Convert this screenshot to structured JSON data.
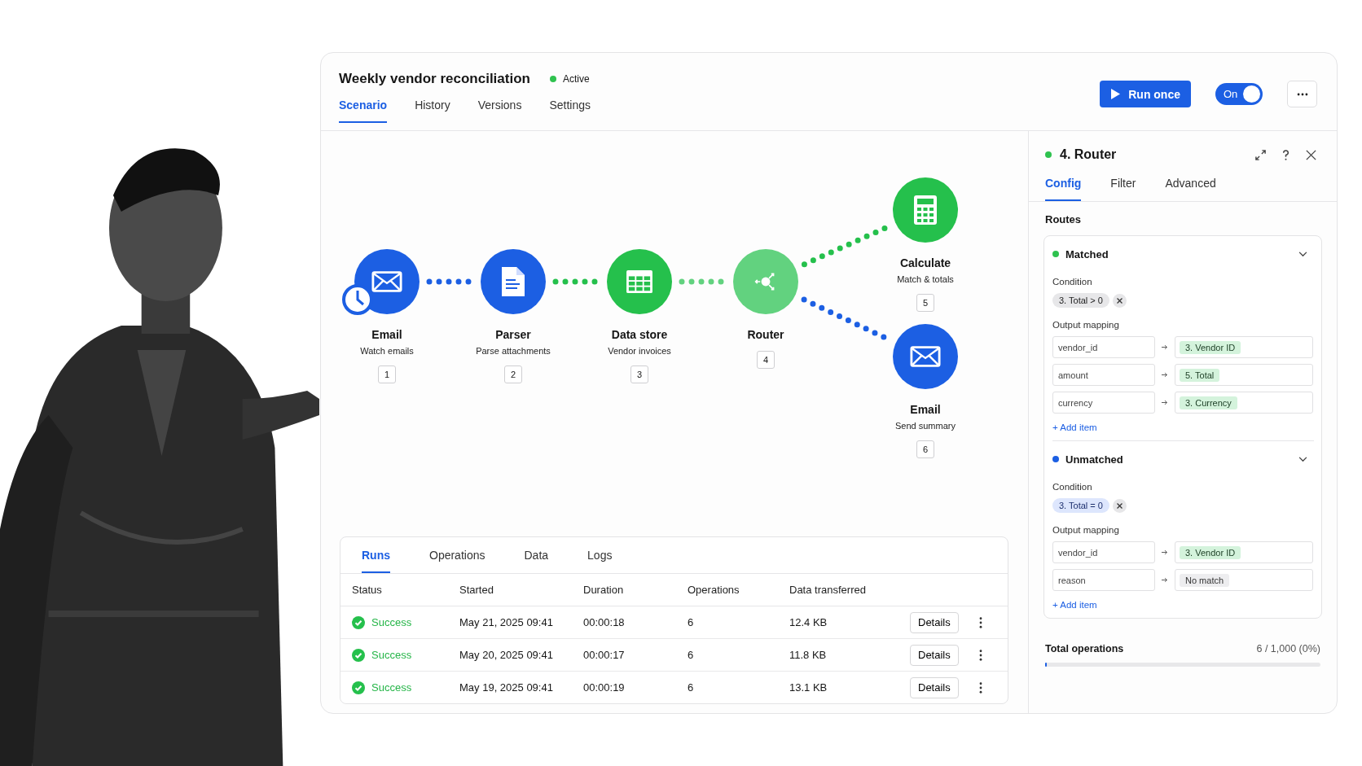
{
  "scenario": {
    "title": "Weekly vendor reconciliation",
    "status": {
      "label": "Active",
      "color": "#2fc24f"
    }
  },
  "tabs": [
    {
      "label": "Scenario",
      "selected": true
    },
    {
      "label": "History",
      "selected": false
    },
    {
      "label": "Versions",
      "selected": false
    },
    {
      "label": "Settings",
      "selected": false
    }
  ],
  "actions": {
    "run_button": "Run once",
    "toggle": {
      "label": "On",
      "on": true
    }
  },
  "flow": {
    "chain": [
      {
        "name": "Email",
        "subtitle": "Watch emails",
        "number": "1",
        "color": "#1c5fe3",
        "kind": "email",
        "scheduled": true
      },
      {
        "name": "Parser",
        "subtitle": "Parse attachments",
        "number": "2",
        "color": "#1c5fe3",
        "kind": "document",
        "scheduled": false
      },
      {
        "name": "Data store",
        "subtitle": "Vendor invoices",
        "number": "3",
        "color": "#25c04c",
        "kind": "table",
        "scheduled": false
      },
      {
        "name": "Router",
        "number": "4",
        "color": "#62d27f",
        "kind": "router",
        "scheduled": false
      }
    ],
    "branches": [
      {
        "name": "Calculate",
        "subtitle": "Match & totals",
        "number": "5",
        "color": "#25c04c",
        "kind": "calculator",
        "scheduled": false
      },
      {
        "name": "Email",
        "subtitle": "Send summary",
        "number": "6",
        "color": "#1c5fe3",
        "kind": "email",
        "scheduled": false
      }
    ]
  },
  "runs": {
    "tabs": [
      {
        "label": "Runs",
        "selected": true
      },
      {
        "label": "Operations",
        "selected": false
      },
      {
        "label": "Data",
        "selected": false
      },
      {
        "label": "Logs",
        "selected": false
      }
    ],
    "columns": [
      "Status",
      "Started",
      "Duration",
      "Operations",
      "Data transferred"
    ],
    "rows": [
      {
        "status": "Success",
        "kind": "success",
        "started": "May 21, 2025 09:41",
        "duration": "00:00:18",
        "operations": "6",
        "data": "12.4 KB",
        "action": "Details"
      },
      {
        "status": "Success",
        "kind": "success",
        "started": "May 20, 2025 09:41",
        "duration": "00:00:17",
        "operations": "6",
        "data": "11.8 KB",
        "action": "Details"
      },
      {
        "status": "Success",
        "kind": "success",
        "started": "May 19, 2025 09:41",
        "duration": "00:00:19",
        "operations": "6",
        "data": "13.1 KB",
        "action": "Details"
      }
    ]
  },
  "panel": {
    "title": "4. Router",
    "status": {
      "color": "#2fc24f"
    },
    "tabs": [
      {
        "label": "Config",
        "selected": true
      },
      {
        "label": "Filter",
        "selected": false
      },
      {
        "label": "Advanced",
        "selected": false
      }
    ],
    "section": "Routes",
    "routes": [
      {
        "name": "Matched",
        "color": "#2fc24f",
        "expanded": true,
        "condition_label": "Condition",
        "condition": "3. Total > 0",
        "condition_selected": false,
        "mapping_label": "Output mapping",
        "add_label": "+ Add item",
        "mappings": [
          {
            "field": "vendor_id",
            "value": "3. Vendor ID",
            "kind": "variable"
          },
          {
            "field": "amount",
            "value": "5. Total",
            "kind": "variable"
          },
          {
            "field": "currency",
            "value": "3. Currency",
            "kind": "variable"
          }
        ]
      },
      {
        "name": "Unmatched",
        "color": "#1c5fe3",
        "expanded": true,
        "condition_label": "Condition",
        "condition": "3. Total = 0",
        "condition_selected": true,
        "mapping_label": "Output mapping",
        "add_label": "+ Add item",
        "mappings": [
          {
            "field": "vendor_id",
            "value": "3. Vendor ID",
            "kind": "variable"
          },
          {
            "field": "reason",
            "value": "No match",
            "kind": "text"
          }
        ]
      }
    ],
    "usage": {
      "label": "Total operations",
      "value": "6 / 1,000 (0%)",
      "level": 0.006
    }
  }
}
